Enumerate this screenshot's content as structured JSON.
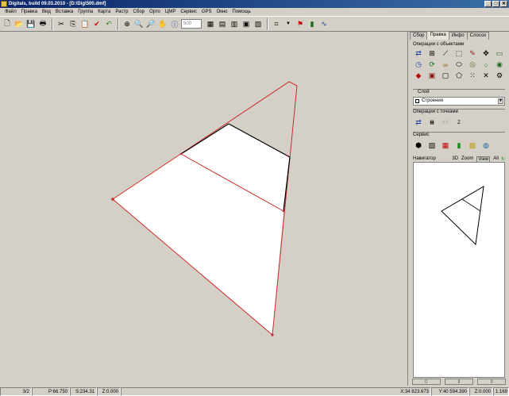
{
  "window": {
    "title": "Digitals, build 09.03.2010 - [D:\\Dig\\500.dmf]",
    "controls": [
      "_",
      "□",
      "✕"
    ]
  },
  "menu": [
    "Файл",
    "Правка",
    "Вид",
    "Вставка",
    "Группа",
    "Карта",
    "Растр",
    "Сбор",
    "Орто",
    "ЦМР",
    "Сервис",
    "GPS",
    "Окно",
    "Помощь"
  ],
  "toolbar": {
    "scale_input": "500"
  },
  "panel": {
    "tabs": [
      "Сбор",
      "Правка",
      "Инфо",
      "Слосоx"
    ],
    "active_tab": "Правка",
    "ops_objects_title": "Операции с объектами",
    "layer_title": "Слой",
    "layer_value": "Строения",
    "ops_points_title": "Операции с точками",
    "ops_points_labels": [
      "XY",
      "Z"
    ],
    "service_title": "Сервис",
    "navigator_title": "Навигатор",
    "navigator_tabs": [
      "3D",
      "Zoom",
      "View",
      "All"
    ]
  },
  "status": {
    "cell1": "3/2",
    "perimeter": "P:66.750",
    "area": "S:234.31",
    "z1": "Z:0.000",
    "x": "X:34 823.673",
    "y": "Y:40 594.390",
    "z2": "Z:0.000",
    "scale": "1:169"
  },
  "colors": {
    "outline_red": "#cc2a2a",
    "polygon_fill": "#ffffff",
    "edge_black": "#000000",
    "canvas_bg": "#d4d0c8"
  }
}
